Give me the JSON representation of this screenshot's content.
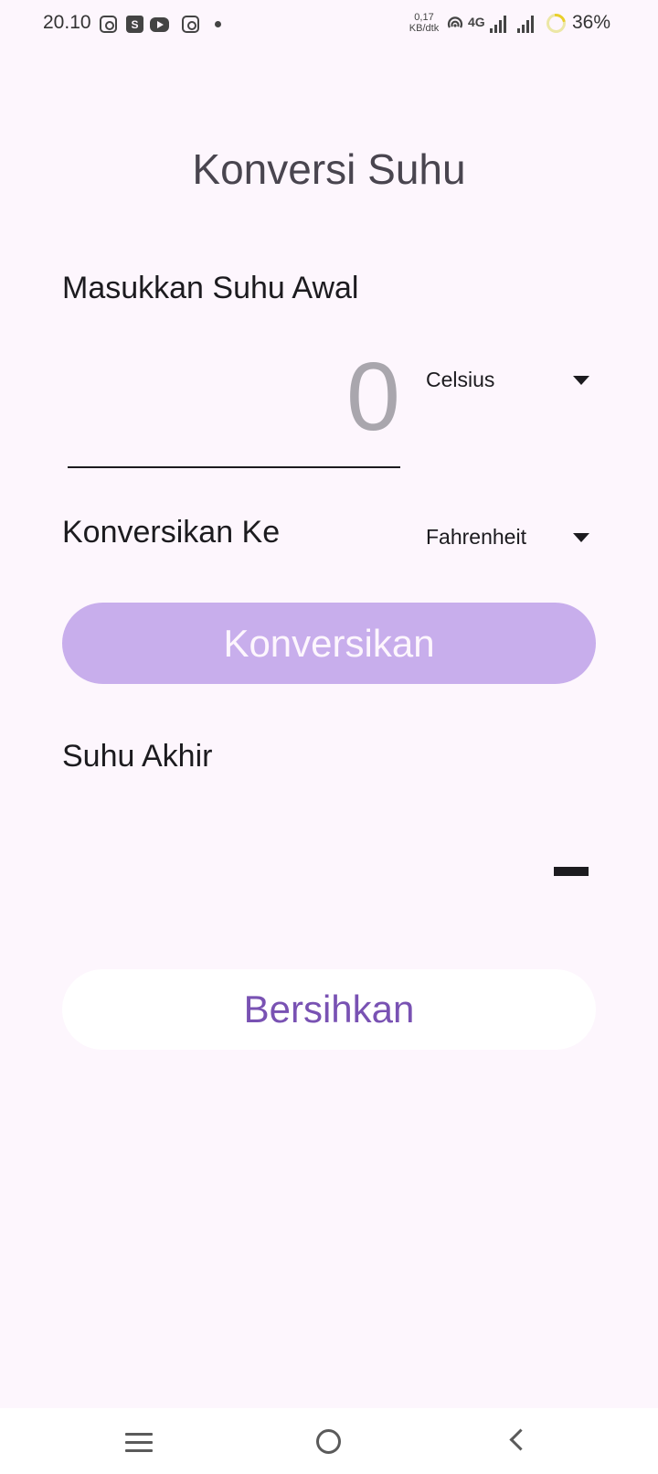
{
  "status_bar": {
    "time": "20.10",
    "notification_icons": [
      "instagram-icon",
      "shopee-icon",
      "youtube-icon",
      "instagram-icon",
      "dot-icon"
    ],
    "net_speed_value": "0,17",
    "net_speed_unit": "KB/dtk",
    "network_type": "4G",
    "battery_percent": "36%"
  },
  "app": {
    "title": "Konversi Suhu",
    "input_label": "Masukkan Suhu Awal",
    "input_placeholder": "0",
    "from_unit": "Celsius",
    "convert_to_label": "Konversikan Ke",
    "to_unit": "Fahrenheit",
    "convert_button": "Konversikan",
    "result_label": "Suhu Akhir",
    "clear_button": "Bersihkan"
  },
  "colors": {
    "background": "#fdf6fd",
    "convert_button_bg": "#c8aeec",
    "clear_button_text": "#7952b3",
    "text_primary": "#1c1b1f",
    "placeholder": "#a9a6ad"
  },
  "nav_bar": {
    "icons": [
      "menu-icon",
      "home-icon",
      "back-icon"
    ]
  }
}
